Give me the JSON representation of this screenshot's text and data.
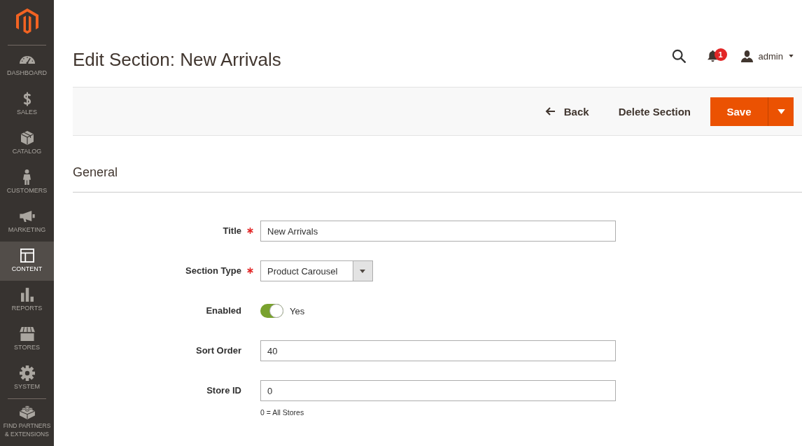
{
  "sidebar": {
    "items": [
      {
        "label": "DASHBOARD",
        "selected": false
      },
      {
        "label": "SALES",
        "selected": false
      },
      {
        "label": "CATALOG",
        "selected": false
      },
      {
        "label": "CUSTOMERS",
        "selected": false
      },
      {
        "label": "MARKETING",
        "selected": false
      },
      {
        "label": "CONTENT",
        "selected": true
      },
      {
        "label": "REPORTS",
        "selected": false
      },
      {
        "label": "STORES",
        "selected": false
      },
      {
        "label": "SYSTEM",
        "selected": false
      }
    ],
    "partners_link": {
      "label": "FIND PARTNERS & EXTENSIONS"
    }
  },
  "page_title": "Edit Section: New Arrivals",
  "header": {
    "notifications": "1",
    "user_name": "admin"
  },
  "action_bar": {
    "buttons": [
      {
        "kind": "back",
        "label": "Back"
      },
      {
        "kind": "delete",
        "label": "Delete Section"
      },
      {
        "kind": "save_split",
        "label": "Save"
      }
    ]
  },
  "section": {
    "title": "General",
    "fields": [
      {
        "kind": "input",
        "label": "Title",
        "required": true,
        "value": "New Arrivals"
      },
      {
        "kind": "select",
        "label": "Section Type",
        "required": true,
        "value": "Product Carousel"
      },
      {
        "kind": "toggle",
        "label": "Enabled",
        "required": false,
        "on": true,
        "value_label": "Yes"
      },
      {
        "kind": "input",
        "label": "Sort Order",
        "required": false,
        "value": "40"
      },
      {
        "kind": "input",
        "label": "Store ID",
        "required": false,
        "value": "0",
        "note": "0 = All Stores"
      }
    ]
  }
}
